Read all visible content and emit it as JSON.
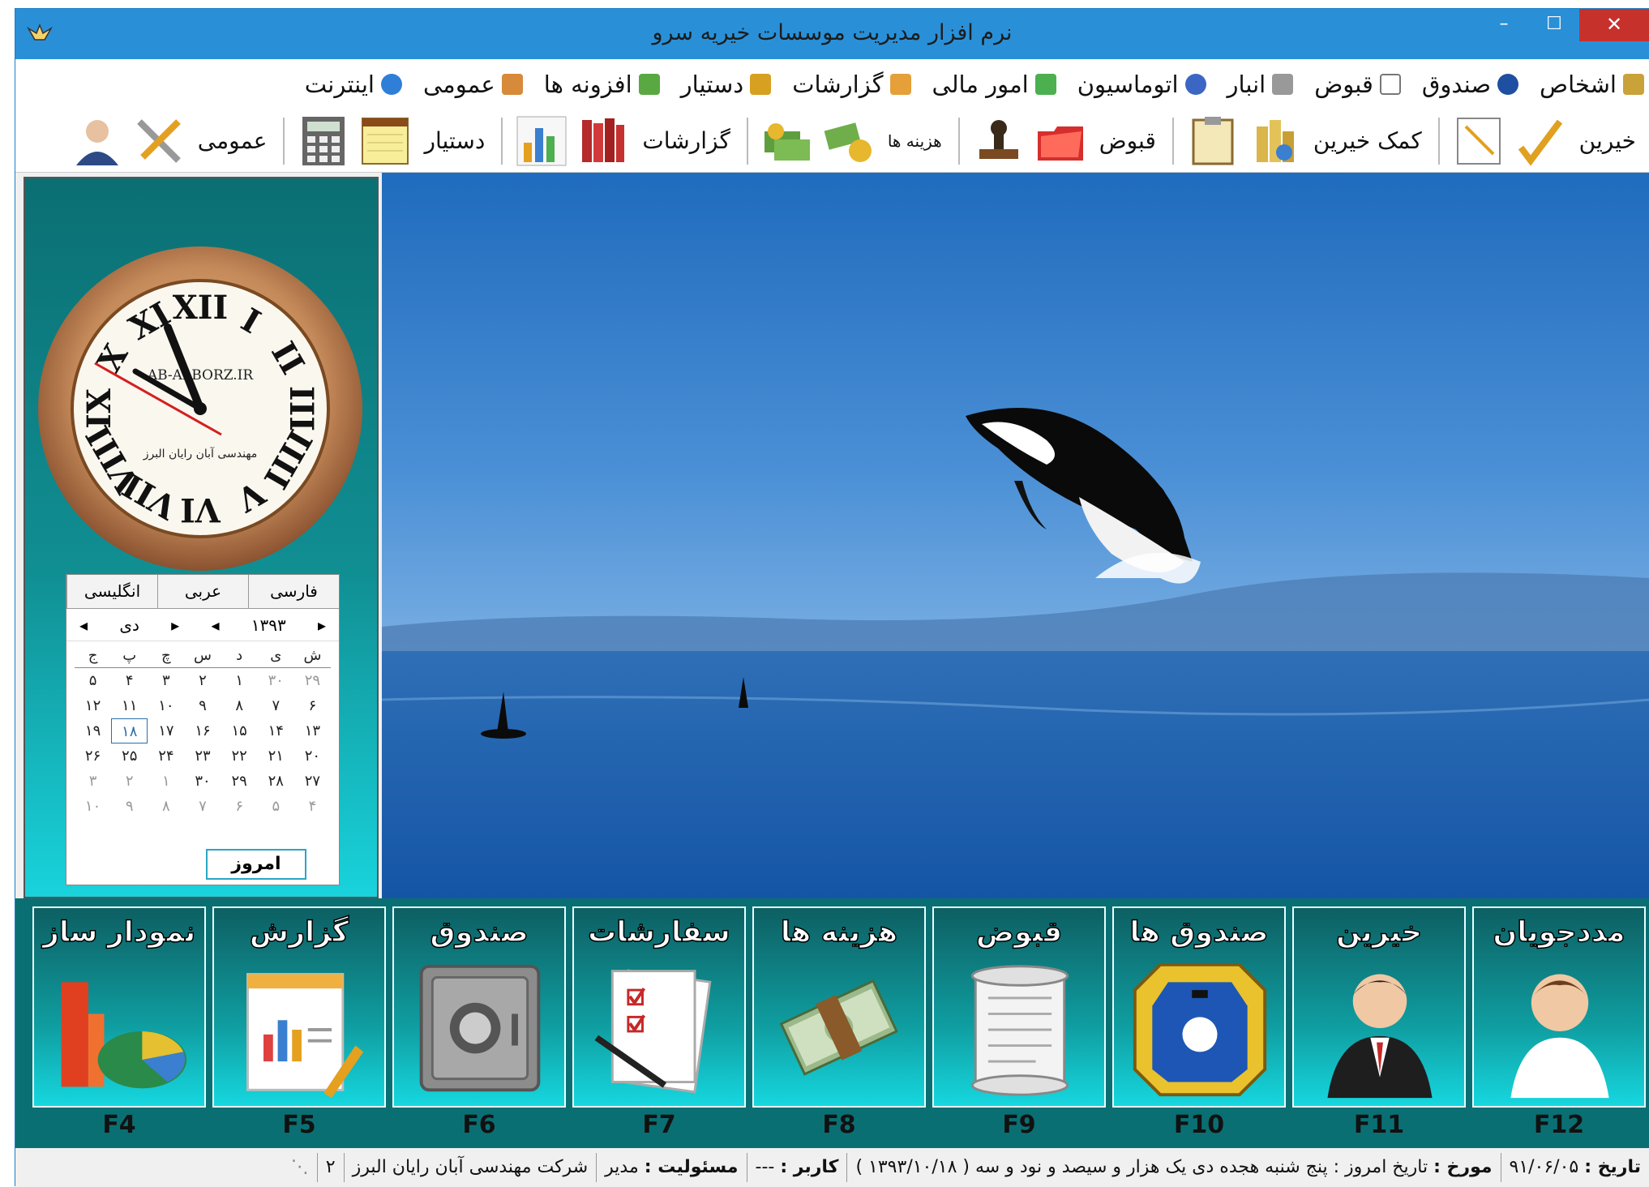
{
  "window": {
    "title": "نرم افزار مدیریت موسسات خیریه سرو",
    "min": "–",
    "max": "☐",
    "close": "✕"
  },
  "menu": [
    "اشخاص",
    "صندوق",
    "قبوض",
    "انبار",
    "اتوماسیون",
    "امور مالی",
    "گزارشات",
    "دستیار",
    "افزونه ها",
    "عمومی",
    "اینترنت"
  ],
  "toolbar": {
    "khayerin": "خیرین",
    "komak": "کمک خیرین",
    "qobuz": "قبوض",
    "hazine": "هزینه ها",
    "gozareshat": "گزارشات",
    "dastyar": "دستیار",
    "omumi": "عمومی"
  },
  "clock": {
    "brand": "AB-ALBORZ.IR",
    "company": "مهندسی آبان رایان البرز",
    "numerals": [
      "XII",
      "I",
      "II",
      "III",
      "IIII",
      "V",
      "VI",
      "VII",
      "VIII",
      "IX",
      "X",
      "XI"
    ]
  },
  "calendar": {
    "tabs": [
      "فارسی",
      "عربی",
      "انگلیسی"
    ],
    "year": "۱۳۹۳",
    "month": "دی",
    "weekdays": [
      "ش",
      "ی",
      "د",
      "س",
      "چ",
      "پ",
      "ج"
    ],
    "rows": [
      [
        "۲۹",
        "۳۰",
        "۱",
        "۲",
        "۳",
        "۴",
        "۵"
      ],
      [
        "۶",
        "۷",
        "۸",
        "۹",
        "۱۰",
        "۱۱",
        "۱۲"
      ],
      [
        "۱۳",
        "۱۴",
        "۱۵",
        "۱۶",
        "۱۷",
        "۱۸",
        "۱۹"
      ],
      [
        "۲۰",
        "۲۱",
        "۲۲",
        "۲۳",
        "۲۴",
        "۲۵",
        "۲۶"
      ],
      [
        "۲۷",
        "۲۸",
        "۲۹",
        "۳۰",
        "۱",
        "۲",
        "۳"
      ],
      [
        "۴",
        "۵",
        "۶",
        "۷",
        "۸",
        "۹",
        "۱۰"
      ]
    ],
    "muted": [
      [
        0,
        0
      ],
      [
        0,
        1
      ],
      [
        4,
        4
      ],
      [
        4,
        5
      ],
      [
        4,
        6
      ],
      [
        5,
        0
      ],
      [
        5,
        1
      ],
      [
        5,
        2
      ],
      [
        5,
        3
      ],
      [
        5,
        4
      ],
      [
        5,
        5
      ],
      [
        5,
        6
      ]
    ],
    "today_cell": [
      2,
      5
    ],
    "today_button": "امروز"
  },
  "big_buttons": [
    {
      "label": "مددجویان",
      "key": "F12",
      "icon": "student-icon"
    },
    {
      "label": "خیرین",
      "key": "F11",
      "icon": "businessman-icon"
    },
    {
      "label": "صندوق ها",
      "key": "F10",
      "icon": "charity-box-icon"
    },
    {
      "label": "قبوض",
      "key": "F9",
      "icon": "scroll-receipt-icon"
    },
    {
      "label": "هزینه ها",
      "key": "F8",
      "icon": "money-stack-icon"
    },
    {
      "label": "سفارشات",
      "key": "F7",
      "icon": "checklist-icon"
    },
    {
      "label": "صندوق",
      "key": "F6",
      "icon": "safe-icon"
    },
    {
      "label": "گزارش",
      "key": "F5",
      "icon": "report-icon"
    },
    {
      "label": "نمودار ساز",
      "key": "F4",
      "icon": "chart-builder-icon"
    }
  ],
  "status": {
    "date_label": "تاریخ :",
    "date_value": "۹۱/۰۶/۰۵",
    "mowarekh_label": "مورخ :",
    "mowarekh_value": "تاریخ امروز : پنج شنبه هجده  دی یک هزار و سیصد و نود و سه ( ۱۳۹۳/۱۰/۱۸ )",
    "user_label": "کاربر :",
    "user_value": "---",
    "role_label": "مسئولیت :",
    "role_value": "مدیر",
    "company": "شرکت مهندسی آبان رایان البرز",
    "num": "۲"
  }
}
